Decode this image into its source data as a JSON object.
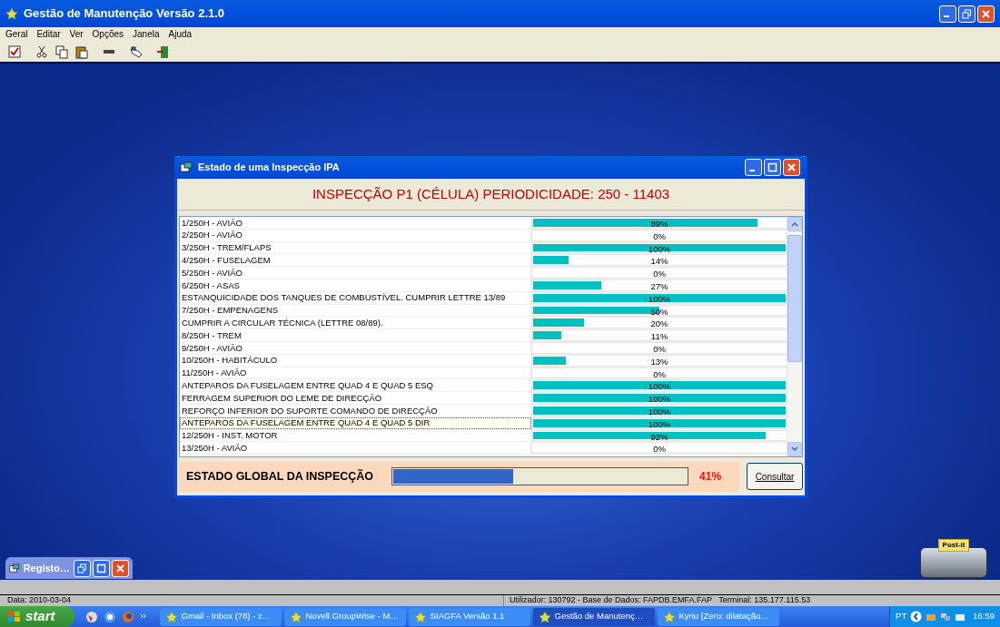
{
  "window": {
    "title": "Gestão de Manutenção Versão 2.1.0"
  },
  "menu": [
    "Geral",
    "Editar",
    "Ver",
    "Opções",
    "Janela",
    "Ajuda"
  ],
  "toolbar": [
    {
      "kind": "check"
    },
    {
      "kind": "cut"
    },
    {
      "kind": "copy"
    },
    {
      "kind": "paste"
    },
    {
      "kind": "bar"
    },
    {
      "kind": "hand"
    },
    {
      "kind": "exit"
    }
  ],
  "dialog": {
    "title": "Estado de uma Inspecção IPA",
    "heading": "INSPECÇÃO P1 (CÉLULA) PERIODICIDADE: 250 - 11403",
    "rows": [
      {
        "name": "1/250H - AVIÃO",
        "level": 0.89,
        "percent": "89%",
        "selected": false
      },
      {
        "name": "2/250H - AVIÃO",
        "percent": "0%",
        "selected": false
      },
      {
        "name": "3/250H - TREM/FLAPS",
        "level": 1,
        "percent": "100%",
        "selected": false
      },
      {
        "name": "4/250H - FUSELAGEM",
        "level": 0.14,
        "percent": "14%",
        "selected": false
      },
      {
        "name": "5/250H - AVIÃO",
        "percent": "0%",
        "selected": false
      },
      {
        "name": "6/250H - ASAS",
        "level": 0.27,
        "percent": "27%",
        "selected": false
      },
      {
        "name": "ESTANQUICIDADE DOS TANQUES DE COMBUSTÍVEL. CUMPRIR LETTRE 13/89",
        "level": 1,
        "percent": "100%",
        "selected": false
      },
      {
        "name": "7/250H - EMPENAGENS",
        "level": 0.5,
        "percent": "50%",
        "selected": false
      },
      {
        "name": "CUMPRIR A CIRCULAR TÉCNICA (LETTRE 08/89).",
        "level": 0.2,
        "percent": "20%",
        "selected": false
      },
      {
        "name": "8/250H - TREM",
        "level": 0.11,
        "percent": "11%",
        "selected": false
      },
      {
        "name": "9/250H - AVIÃO",
        "percent": "0%",
        "selected": false
      },
      {
        "name": "10/250H - HABITÁCULO",
        "level": 0.13,
        "percent": "13%",
        "selected": false
      },
      {
        "name": "11/250H - AVIÃO",
        "percent": "0%",
        "selected": false
      },
      {
        "name": "ANTEPAROS DA FUSELAGEM ENTRE QUAD 4 E QUAD 5 ESQ",
        "level": 1,
        "percent": "100%",
        "selected": false
      },
      {
        "name": "FERRAGEM SUPERIOR DO LEME DE DIRECÇÃO",
        "level": 1,
        "percent": "100%",
        "selected": false
      },
      {
        "name": "REFORÇO INFERIOR DO SUPORTE COMANDO DE DIRECÇÃO",
        "level": 1,
        "percent": "100%",
        "selected": false
      },
      {
        "name": "ANTEPAROS DA FUSELAGEM ENTRE QUAD 4 E QUAD 5 DIR",
        "level": 1,
        "percent": "100%",
        "selected": true
      },
      {
        "name": "12/250H - INST. MOTOR",
        "level": 0.92,
        "percent": "92%",
        "selected": false
      },
      {
        "name": "13/250H - AVIÃO",
        "percent": "0%",
        "selected": false
      }
    ],
    "global": {
      "label": "ESTADO GLOBAL DA INSPECÇÃO",
      "level": 0.41,
      "percent": "41%"
    },
    "button": "Consultar"
  },
  "minimized_window": {
    "title": "Registo…"
  },
  "postit_label": "Post-it",
  "status_bar": {
    "date": "Data: 2010-03-04",
    "info": "Utilizador: 130792 - Base de Dados: FAPDB.EMFA.FAP   Terminal: 135.177.115.53"
  },
  "taskbar": {
    "start": "start",
    "items": [
      {
        "label": "Gmail - Inbox (78) - z…",
        "selected": false
      },
      {
        "label": "Novell GroupWise - M…",
        "selected": false
      },
      {
        "label": "SIAGFA Versão 1.1",
        "selected": false
      },
      {
        "label": "Gestão de Manutenç…",
        "selected": true
      },
      {
        "label": "Kyriu [Zero: dilatação…",
        "selected": false
      }
    ],
    "language": "PT",
    "clock": "16:59"
  }
}
